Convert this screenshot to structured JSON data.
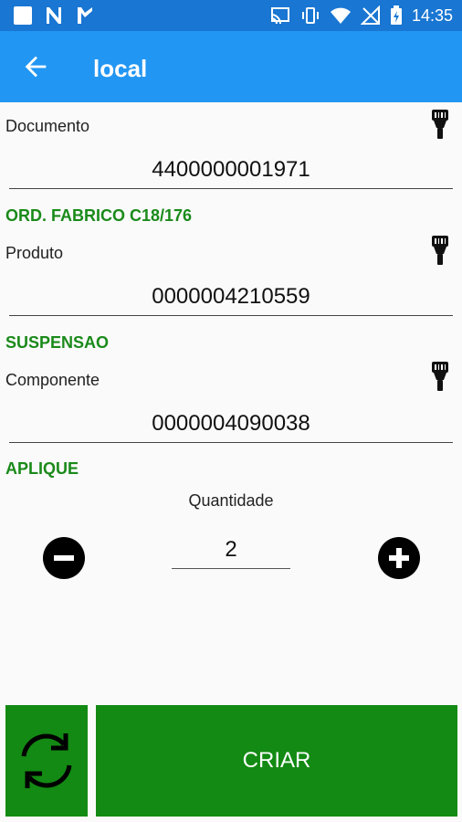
{
  "status_bar": {
    "time": "14:35",
    "left_icons": [
      "square-icon",
      "n-icon",
      "check-flag-icon"
    ],
    "right_icons": [
      "cast-icon",
      "vibrate-icon",
      "wifi-icon",
      "no-signal-icon",
      "battery-charging-icon"
    ]
  },
  "app_bar": {
    "title": "local",
    "back_icon": "arrow-left-icon",
    "color": "#2196f3"
  },
  "documento": {
    "label": "Documento",
    "value": "4400000001971",
    "info": "ORD. FABRICO C18/176"
  },
  "produto": {
    "label": "Produto",
    "value": "0000004210559",
    "info": "SUSPENSAO"
  },
  "componente": {
    "label": "Componente",
    "value": "0000004090038",
    "info": "APLIQUE"
  },
  "quantidade": {
    "label": "Quantidade",
    "value": "2"
  },
  "actions": {
    "create_label": "CRIAR",
    "button_color": "#138a13"
  }
}
